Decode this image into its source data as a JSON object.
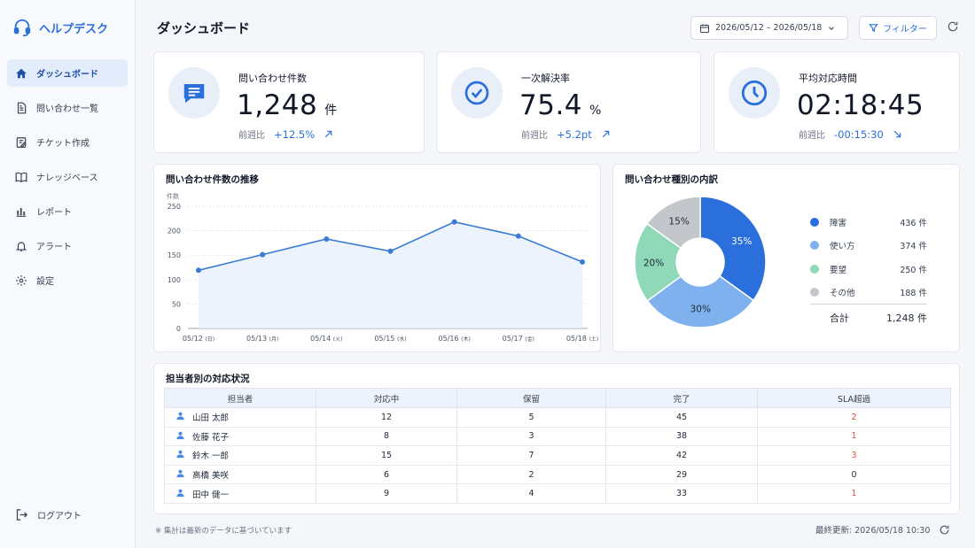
{
  "app": {
    "title": "ヘルプデスク"
  },
  "sidebar": {
    "items": [
      {
        "label": "ダッシュボード",
        "icon": "home-icon",
        "active": true
      },
      {
        "label": "問い合わせ一覧",
        "icon": "document-list-icon"
      },
      {
        "label": "チケット作成",
        "icon": "ticket-edit-icon"
      },
      {
        "label": "ナレッジベース",
        "icon": "book-icon"
      },
      {
        "label": "レポート",
        "icon": "bar-chart-icon"
      },
      {
        "label": "アラート",
        "icon": "bell-icon"
      },
      {
        "label": "設定",
        "icon": "gear-icon"
      }
    ],
    "logout": "ログアウト"
  },
  "header": {
    "title": "ダッシュボード",
    "date_range": "2026/05/12 – 2026/05/18",
    "filter_label": "フィルター"
  },
  "kpis": [
    {
      "label": "問い合わせ件数",
      "value": "1,248",
      "unit": "件",
      "comp_label": "前週比",
      "delta": "+12.5%",
      "trend": "up",
      "icon": "chat-bubble-icon"
    },
    {
      "label": "一次解決率",
      "value": "75.4",
      "unit": "%",
      "comp_label": "前週比",
      "delta": "+5.2pt",
      "trend": "up",
      "icon": "check-circle-icon"
    },
    {
      "label": "平均対応時間",
      "value": "02:18:45",
      "unit": "",
      "comp_label": "前週比",
      "delta": "-00:15:30",
      "trend": "down",
      "icon": "clock-icon"
    }
  ],
  "line_chart": {
    "title": "問い合わせ件数の推移"
  },
  "donut": {
    "title": "問い合わせ種別の内訳",
    "total_label": "合計",
    "total_value": "1,248 件"
  },
  "chart_data": [
    {
      "type": "line",
      "title": "問い合わせ件数の推移",
      "ylabel": "件数",
      "categories": [
        "05/12 (日)",
        "05/13 (月)",
        "05/14 (火)",
        "05/15 (水)",
        "05/16 (木)",
        "05/17 (金)",
        "05/18 (土)"
      ],
      "values": [
        119,
        151,
        183,
        158,
        218,
        189,
        136
      ],
      "ylim": [
        0,
        250
      ],
      "yticks": [
        0,
        50,
        100,
        150,
        200,
        250
      ],
      "grid": true,
      "color": "#3a7bd5"
    },
    {
      "type": "pie",
      "title": "問い合わせ種別の内訳",
      "slices": [
        {
          "name": "障害",
          "count": "436 件",
          "value": 436,
          "pct": "35%",
          "color": "#2a6fdb"
        },
        {
          "name": "使い方",
          "count": "374 件",
          "value": 374,
          "pct": "30%",
          "color": "#7fb1ee"
        },
        {
          "name": "要望",
          "count": "250 件",
          "value": 250,
          "pct": "20%",
          "color": "#8fd8b8"
        },
        {
          "name": "その他",
          "count": "188 件",
          "value": 188,
          "pct": "15%",
          "color": "#c3c6cb"
        }
      ],
      "legend": "right"
    }
  ],
  "status_table": {
    "title": "担当者別の対応状況",
    "headers": [
      "担当者",
      "対応中",
      "保留",
      "完了",
      "SLA超過"
    ],
    "rows": [
      [
        "山田 太郎",
        "12",
        "5",
        "45",
        "2"
      ],
      [
        "佐藤 花子",
        "8",
        "3",
        "38",
        "1"
      ],
      [
        "鈴木 一郎",
        "15",
        "7",
        "42",
        "3"
      ],
      [
        "高橋 美咲",
        "6",
        "2",
        "29",
        "0"
      ],
      [
        "田中 健一",
        "9",
        "4",
        "33",
        "1"
      ]
    ]
  },
  "footer": {
    "note": "※ 集計は最新のデータに基づいています",
    "updated": "最終更新: 2026/05/18 10:30"
  }
}
